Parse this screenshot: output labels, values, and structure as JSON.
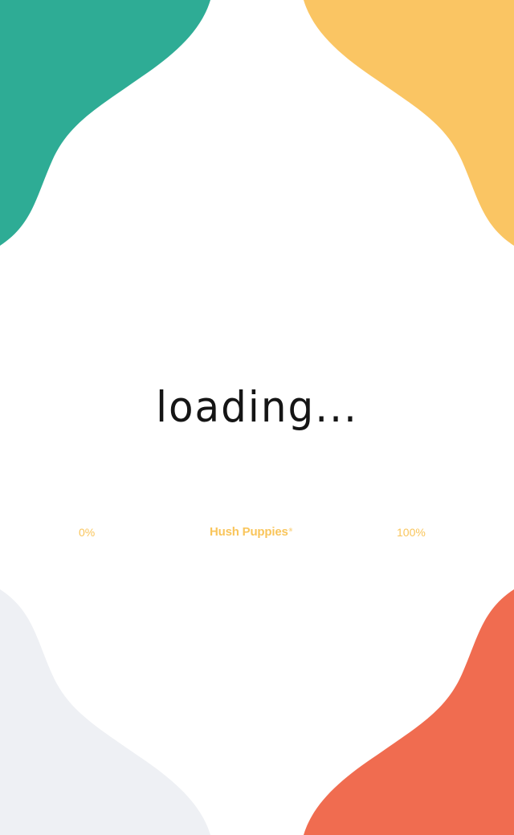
{
  "loading": {
    "text": "loading..."
  },
  "progress": {
    "start_label": "0%",
    "end_label": "100%",
    "value_fraction": 0
  },
  "brand": {
    "name": "Hush Puppies",
    "mark": "®"
  },
  "colors": {
    "background": "#ffffff",
    "blob_top_left": "#2eac95",
    "blob_top_right": "#fac563",
    "blob_bottom_left": "#eef0f4",
    "blob_bottom_right": "#f06c50",
    "accent_text": "#f9c55b",
    "loading_text": "#151515"
  }
}
